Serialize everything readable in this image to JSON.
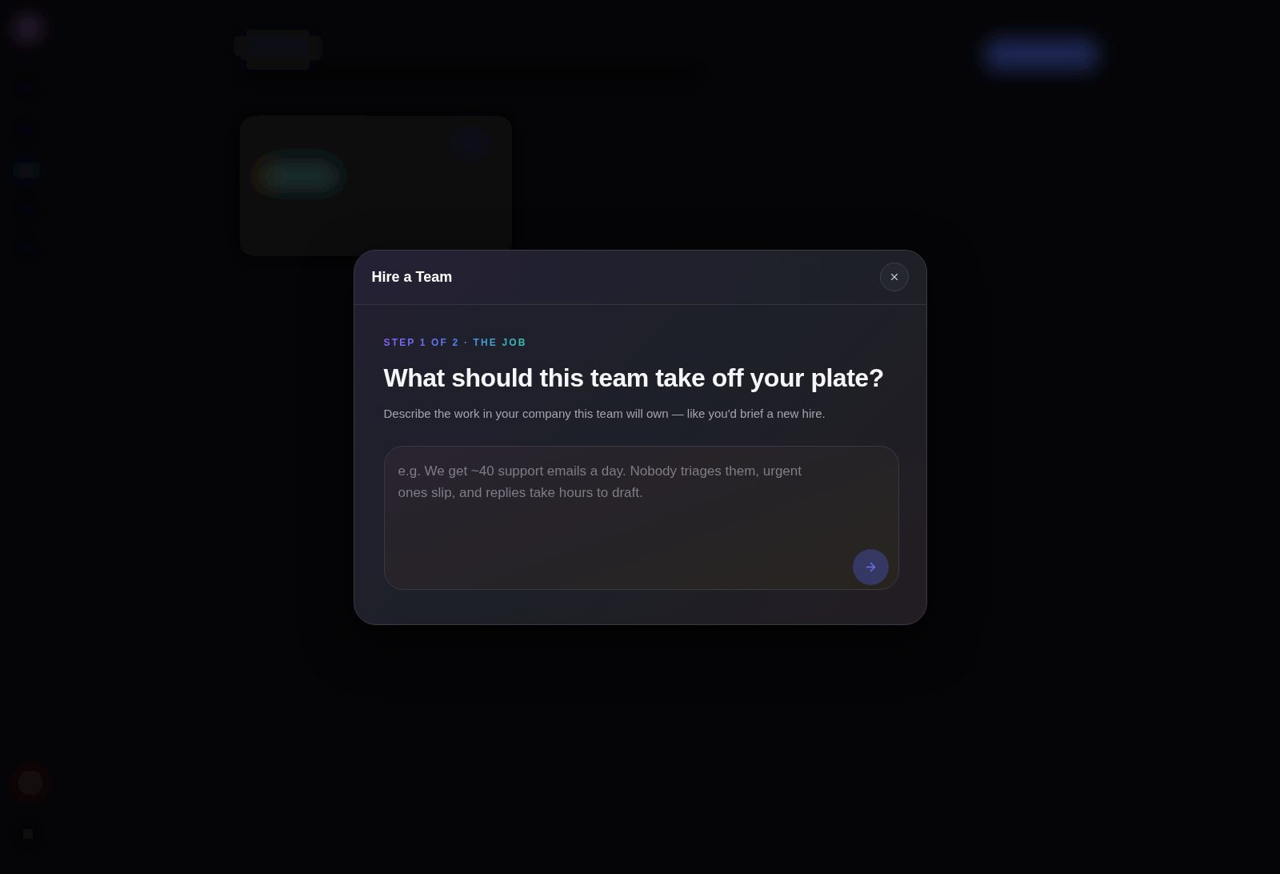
{
  "dialog": {
    "title": "Hire a Team",
    "step_label": "STEP 1 OF 2 · THE JOB",
    "heading": "What should this team take off your plate?",
    "description": "Describe the work in your company this team will own — like you'd brief a new hire.",
    "job_input": {
      "placeholder": "e.g. We get ~40 support emails a day. Nobody triages them, urgent ones slip, and replies take hours to draft."
    }
  }
}
